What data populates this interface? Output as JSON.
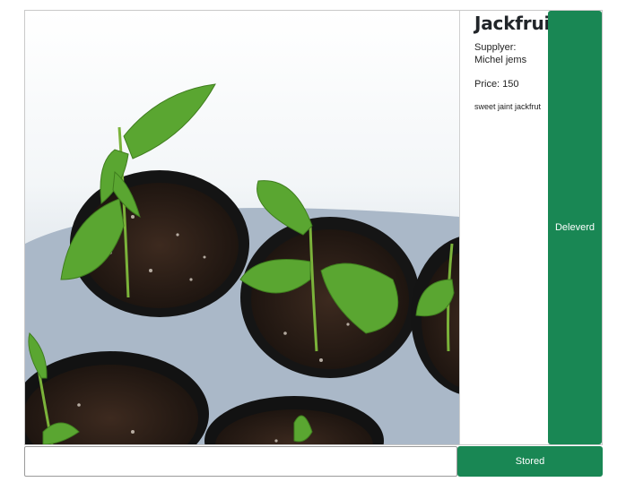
{
  "product": {
    "name": "Jackfruit",
    "supplier_line": "Supplyer: Michel jems",
    "price_line": "Price: 150",
    "description": "sweet jaint jackfrut",
    "image_name": "jackfruit-seedlings-photo"
  },
  "actions": {
    "delivered_label": "Deleverd",
    "stored_label": "Stored"
  },
  "input": {
    "value": "",
    "placeholder": ""
  },
  "colors": {
    "button_green": "#198754",
    "border_gray": "#c9c9c9"
  }
}
